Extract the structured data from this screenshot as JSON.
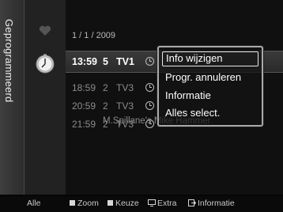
{
  "rail": {
    "label": "Geprogrammeerd"
  },
  "list": {
    "date": "1 / 1 / 2009",
    "selected": {
      "time": "13:59",
      "num": "5",
      "channel": "TV1"
    },
    "rows": [
      {
        "time": "18:59",
        "num": "2",
        "channel": "TV3"
      },
      {
        "time": "20:59",
        "num": "2",
        "channel": "TV3"
      },
      {
        "time": "21:59",
        "num": "2",
        "channel": "TV3"
      }
    ],
    "background_title": "M.Spillane's Mike Hammer"
  },
  "popup": {
    "items": [
      {
        "label": "Info wijzigen",
        "active": true
      },
      {
        "label": "Progr. annuleren",
        "active": false
      },
      {
        "label": "Informatie",
        "active": false
      },
      {
        "label": "Alles select.",
        "active": false
      }
    ]
  },
  "bottom": {
    "alle": "Alle",
    "zoom": "Zoom",
    "keuze": "Keuze",
    "extra": "Extra",
    "informatie": "Informatie"
  },
  "icons": {
    "heart": "heart-icon",
    "timer": "timer-clock-icon",
    "row_clock": "clock-icon",
    "extra": "extra-icon",
    "info": "info-icon"
  },
  "colors": {
    "selected_row": "#333333",
    "popup_border": "#a9a9a9",
    "text": "#ffffff",
    "dim_text": "#8c8c8c"
  }
}
